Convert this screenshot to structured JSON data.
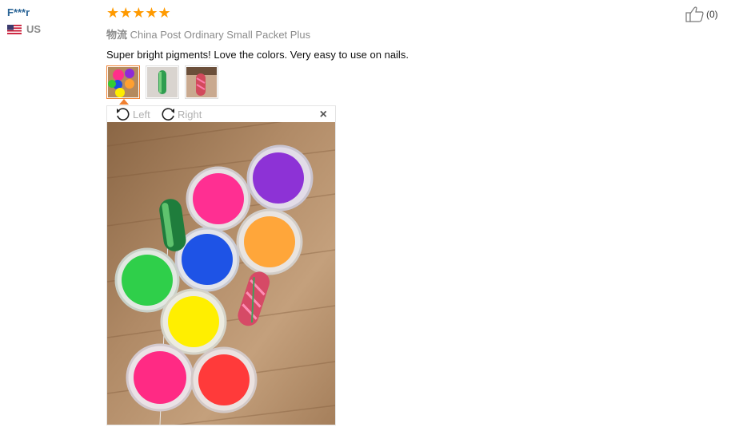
{
  "reviewer": {
    "name": "F***r",
    "country": "US"
  },
  "review": {
    "rating": 5,
    "stars": "★★★★★",
    "shipping_label": "物流",
    "shipping_method": "China Post Ordinary Small Packet Plus",
    "text": "Super bright pigments! Love the colors. Very easy to use on nails."
  },
  "helpful": {
    "count": "(0)",
    "icon": "thumbs-up-icon"
  },
  "viewer": {
    "rotate_left": "Left",
    "rotate_right": "Right",
    "close": "×"
  },
  "colors": {
    "star": "#ff9a00",
    "active_border": "#f08030",
    "name": "#2a6496"
  }
}
